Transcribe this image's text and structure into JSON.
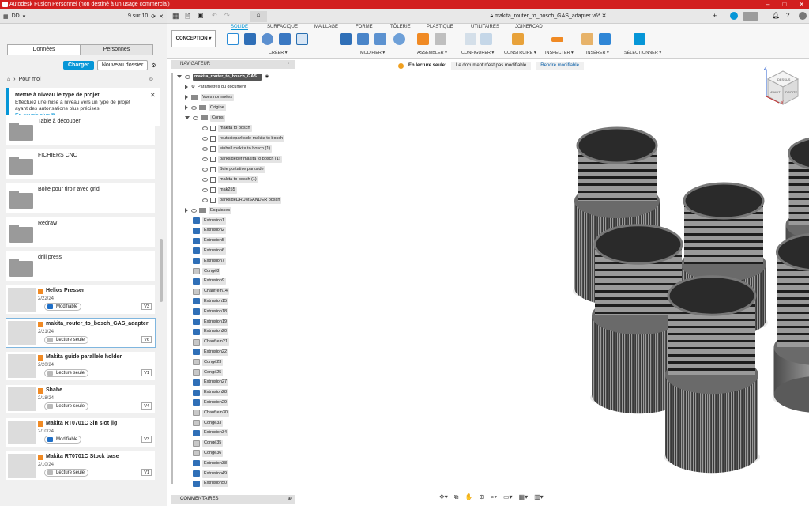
{
  "app_title": "Autodesk Fusion Personnel (non destiné à un usage commercial)",
  "left": {
    "workspace": "DD",
    "page_count": "9 sur 10",
    "tabs": [
      "Données",
      "Personnes"
    ],
    "btn_upload": "Charger",
    "btn_new_folder": "Nouveau dossier",
    "breadcrumb": "Pour moi",
    "notice": {
      "title": "Mettre à niveau le type de projet",
      "body": "Effectuez une mise à niveau vers un type de projet ayant des autorisations plus précises.",
      "link": "En savoir plus"
    },
    "folders": [
      "Table à découper",
      "FICHIERS CNC",
      "Boite pour tiroir avec grid",
      "Redraw",
      "drill press"
    ],
    "files": [
      {
        "name": "Helios Presser",
        "date": "2/22/24",
        "status": "Modifiable",
        "ver": "V3"
      },
      {
        "name": "makita_router_to_bosch_GAS_adapter",
        "date": "2/21/24",
        "status": "Lecture seule",
        "ver": "V6"
      },
      {
        "name": "Makita guide parallele holder",
        "date": "2/20/24",
        "status": "Lecture seule",
        "ver": "V1"
      },
      {
        "name": "Shahe",
        "date": "2/18/24",
        "status": "Lecture seule",
        "ver": "V4"
      },
      {
        "name": "Makita RT0701C 3in slot jig",
        "date": "2/10/24",
        "status": "Modifiable",
        "ver": "V3"
      },
      {
        "name": "Makita RT0701C Stock base",
        "date": "2/10/24",
        "status": "Lecture seule",
        "ver": "V1"
      }
    ]
  },
  "doc_tab": "makita_router_to_bosch_GAS_adapter v6*",
  "ribbon": {
    "tabs": [
      "SOLIDE",
      "SURFACIQUE",
      "MAILLAGE",
      "FORME",
      "TÔLERIE",
      "PLASTIQUE",
      "UTILITAIRES",
      "JOINERCAD"
    ],
    "workspace": "CONCEPTION",
    "groups": [
      "CRÉER",
      "MODIFIER",
      "ASSEMBLER",
      "CONFIGURER",
      "CONSTRUIRE",
      "INSPECTER",
      "INSÉRER",
      "SÉLECTIONNER"
    ]
  },
  "readonly_bar": {
    "label": "En lecture seule:",
    "msg": "Le document n'est pas modifiable",
    "action": "Rendre modifiable"
  },
  "browser": {
    "title": "NAVIGATEUR",
    "root": "makita_router_to_bosch_GAS...",
    "nodes": [
      "Paramètres du document",
      "Vues nommées",
      "Origine",
      "Corps"
    ],
    "bodies": [
      "makita to bosch",
      "routscieparkside makita to bosch",
      "einhell makita to bosch (1)",
      "parksidedef makita to bosch (1)",
      "Scie portative parkside",
      "makita to bosch (1)",
      "mak255",
      "parksideDRUMSANDER bosch"
    ],
    "sketches": "Esquisses",
    "features": [
      "Extrusion1",
      "Extrusion2",
      "Extrusion5",
      "Extrusion6",
      "Extrusion7",
      "Congé8",
      "Extrusion9",
      "Chanfrein14",
      "Extrusion15",
      "Extrusion18",
      "Extrusion19",
      "Extrusion20",
      "Chanfrein21",
      "Extrusion22",
      "Congé23",
      "Congé25",
      "Extrusion27",
      "Extrusion28",
      "Extrusion29",
      "Chanfrein30",
      "Congé33",
      "Extrusion34",
      "Congé35",
      "Congé36",
      "Extrusion38",
      "Extrusion49",
      "Extrusion50"
    ],
    "comments": "COMMENTAIRES"
  },
  "viewcube": {
    "top": "DESSUS",
    "front": "AVANT",
    "right": "DROITE"
  }
}
